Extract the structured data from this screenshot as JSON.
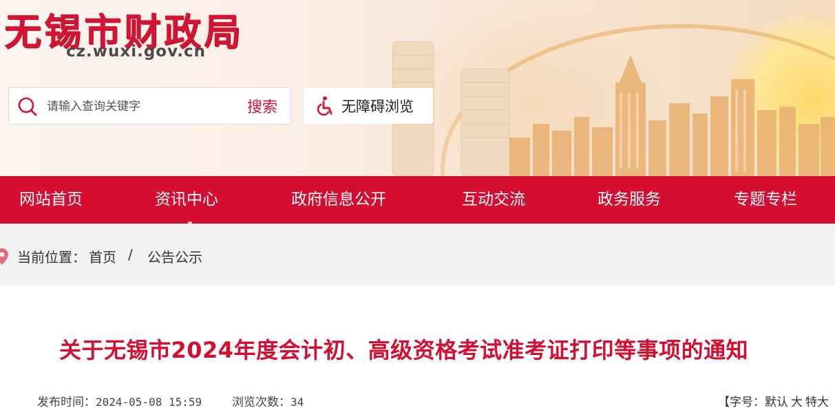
{
  "header": {
    "site_title": "无锡市财政局",
    "site_domain": "cz.wuxi.gov.cn",
    "search": {
      "placeholder": "请输入查询关键字",
      "button_label": "搜索"
    },
    "accessibility_label": "无障碍浏览"
  },
  "nav": {
    "items": [
      {
        "label": "网站首页"
      },
      {
        "label": "资讯中心"
      },
      {
        "label": "政府信息公开"
      },
      {
        "label": "互动交流"
      },
      {
        "label": "政务服务"
      },
      {
        "label": "专题专栏"
      }
    ],
    "active_index": 1
  },
  "breadcrumb": {
    "prefix": "当前位置：",
    "items": [
      "首页",
      "公告公示"
    ],
    "separator": "/"
  },
  "article": {
    "title": "关于无锡市2024年度会计初、高级资格考试准考证打印等事项的通知",
    "publish_label": "发布时间：",
    "publish_time": "2024-05-08 15:59",
    "views_label": "浏览次数：",
    "views": "34",
    "font_size": {
      "prefix": "【字号：",
      "options": [
        "默认",
        "大",
        "特大"
      ]
    }
  },
  "colors": {
    "brand_red": "#d50d31",
    "breadcrumb_bg": "#f2f1f4"
  },
  "icons": [
    "search-icon",
    "wheelchair-icon",
    "location-pin-icon"
  ]
}
